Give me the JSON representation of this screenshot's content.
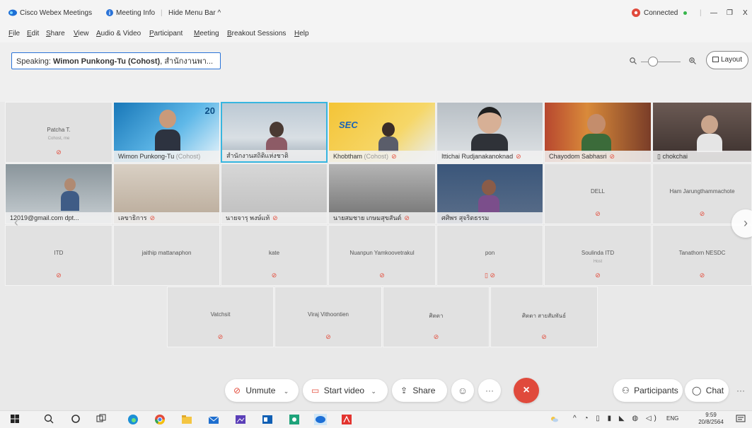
{
  "titlebar": {
    "app_title": "Cisco Webex Meetings",
    "meeting_info": "Meeting Info",
    "hide_menu": "Hide Menu Bar ^",
    "connected": "Connected",
    "min": "—",
    "restore": "❐",
    "close": "X"
  },
  "menu": [
    "File",
    "Edit",
    "Share",
    "View",
    "Audio & Video",
    "Participant",
    "Meeting",
    "Breakout Sessions",
    "Help"
  ],
  "speaking": {
    "prefix": "Speaking:",
    "name": "Wimon Punkong-Tu (Cohost)",
    "suffix": ", สำนักงานพา..."
  },
  "layout_label": "Layout",
  "tiles": {
    "r1": [
      {
        "name": "Patcha T.",
        "sub": "Cohost, me"
      },
      {
        "name": "Wimon Punkong-Tu",
        "role": "(Cohost)",
        "banner": "20"
      },
      {
        "name": "สำนักงานสถิติแห่งชาติ"
      },
      {
        "name": "Khobtham",
        "role": "(Cohost)",
        "banner": "SEC"
      },
      {
        "name": "Ittichai Rudjanakanoknad"
      },
      {
        "name": "Chayodom Sabhasri"
      },
      {
        "name": "chokchai"
      }
    ],
    "r2": [
      {
        "name": "12019@gmail.com dpt..."
      },
      {
        "name": "เลขาธิการ"
      },
      {
        "name": "นายจารุ พงษ์แท้"
      },
      {
        "name": "นายสมชาย เกษมสุขสันต์"
      },
      {
        "name": "ศศิพร สุจริตธรรม"
      },
      {
        "name": "DELL"
      },
      {
        "name": "Ham Jarungthammachote"
      }
    ],
    "r3": [
      {
        "name": "ITD"
      },
      {
        "name": "jaithip mattanaphon"
      },
      {
        "name": "kate"
      },
      {
        "name": "Nuanpun Yamkoovetrakul"
      },
      {
        "name": "pon"
      },
      {
        "name": "Soulinda ITD",
        "sub": "Host"
      },
      {
        "name": "Tanathorn NESDC"
      }
    ],
    "r4": [
      {
        "name": "Vatchsit"
      },
      {
        "name": "Viraj Vithoontien"
      },
      {
        "name": "ศิตตา"
      },
      {
        "name": "ศิตตา สายสัมพันธ์"
      }
    ]
  },
  "controls": {
    "unmute": "Unmute",
    "start_video": "Start video",
    "share": "Share",
    "more": "···",
    "participants": "Participants",
    "chat": "Chat"
  },
  "taskbar": {
    "time": "9:59",
    "date": "20/8/2564",
    "lang": "ENG"
  },
  "colors": {
    "accent": "#2a73d8",
    "mute_red": "#e34b3a",
    "leave_red": "#e04a3c",
    "connected_green": "#35b54a"
  }
}
